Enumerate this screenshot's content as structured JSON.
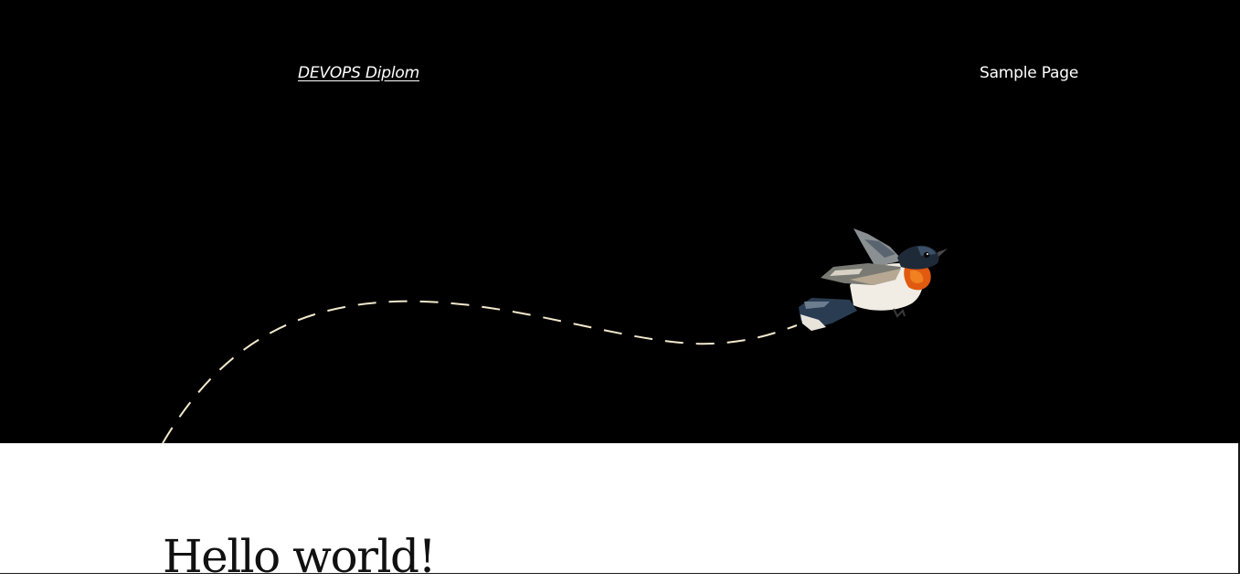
{
  "header": {
    "site_title": "DEVOPS Diplom",
    "nav_items": [
      {
        "label": "Sample Page"
      }
    ]
  },
  "hero": {
    "background_color": "#000000",
    "flight_path_color": "#f3e8cc",
    "illustration": "flying-bird"
  },
  "post": {
    "title": "Hello world!"
  }
}
